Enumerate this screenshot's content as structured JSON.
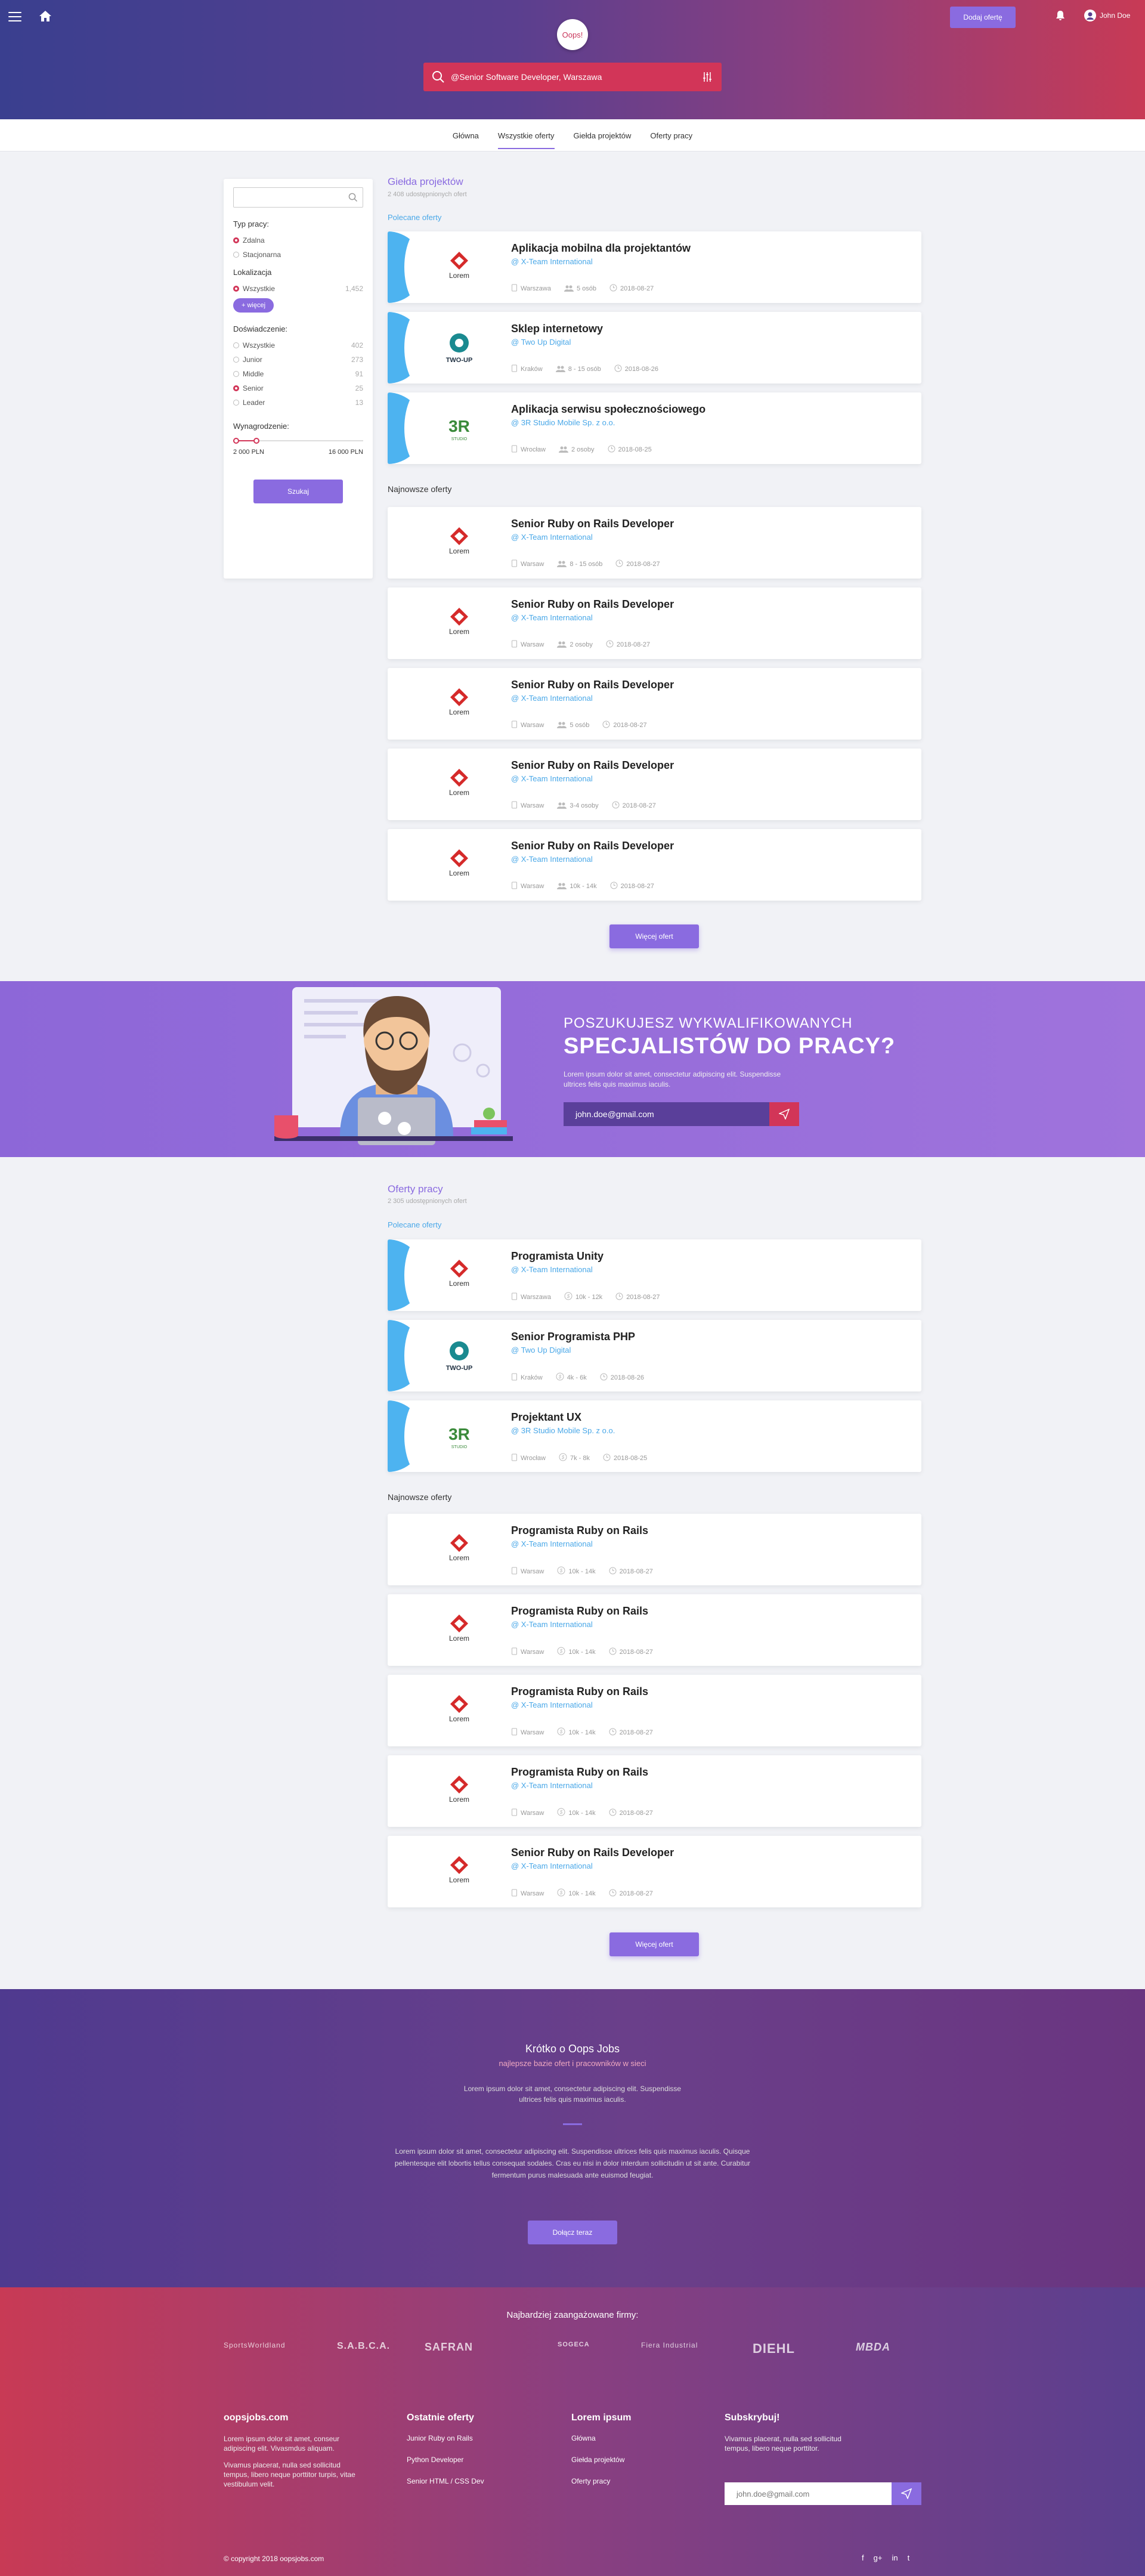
{
  "header": {
    "logo": "Oops!",
    "add_offer": "Dodaj ofertę",
    "user": "John Doe",
    "search": "@Senior Software Developer, Warszawa"
  },
  "tabs": [
    "Główna",
    "Wszystkie oferty",
    "Giełda projektów",
    "Oferty pracy"
  ],
  "sidebar": {
    "work_type_title": "Typ pracy:",
    "work_types": [
      "Zdalna",
      "Stacjonarna"
    ],
    "location_title": "Lokalizacja",
    "location": {
      "label": "Wszystkie",
      "count": "1,452"
    },
    "more": "+ więcej",
    "exp_title": "Doświadczenie:",
    "exp": [
      {
        "label": "Wszystkie",
        "count": "402"
      },
      {
        "label": "Junior",
        "count": "273"
      },
      {
        "label": "Middle",
        "count": "91"
      },
      {
        "label": "Senior",
        "count": "25"
      },
      {
        "label": "Leader",
        "count": "13"
      }
    ],
    "salary_title": "Wynagrodzenie:",
    "salary_min": "2 000 PLN",
    "salary_max": "16 000 PLN",
    "salary_fraction": 0.18,
    "search_btn": "Szukaj"
  },
  "projects": {
    "title": "Giełda projektów",
    "subtitle": "2 408 udostępnionych ofert",
    "featured_label": "Polecane oferty",
    "newest_label": "Najnowsze oferty",
    "more_btn": "Więcej ofert",
    "featured": [
      {
        "title": "Aplikacja mobilna dla projektantów",
        "company": "@ X-Team International",
        "city": "Warszawa",
        "people": "5 osób",
        "date": "2018-08-27",
        "logo": "Lorem"
      },
      {
        "title": "Sklep internetowy",
        "company": "@ Two Up Digital",
        "city": "Kraków",
        "people": "8 - 15 osób",
        "date": "2018-08-26",
        "logo": "TWO-UP"
      },
      {
        "title": "Aplikacja serwisu społecznościowego",
        "company": "@ 3R Studio Mobile Sp. z o.o.",
        "city": "Wrocław",
        "people": "2 osoby",
        "date": "2018-08-25",
        "logo": "3R"
      }
    ],
    "newest": [
      {
        "title": "Senior Ruby on Rails Developer",
        "company": "@ X-Team International",
        "city": "Warsaw",
        "people": "8 - 15 osób",
        "date": "2018-08-27",
        "logo": "Lorem"
      },
      {
        "title": "Senior Ruby on Rails Developer",
        "company": "@ X-Team International",
        "city": "Warsaw",
        "people": "2 osoby",
        "date": "2018-08-27",
        "logo": "Lorem"
      },
      {
        "title": "Senior Ruby on Rails Developer",
        "company": "@ X-Team International",
        "city": "Warsaw",
        "people": "5 osób",
        "date": "2018-08-27",
        "logo": "Lorem"
      },
      {
        "title": "Senior Ruby on Rails Developer",
        "company": "@ X-Team International",
        "city": "Warsaw",
        "people": "3-4 osoby",
        "date": "2018-08-27",
        "logo": "Lorem"
      },
      {
        "title": "Senior Ruby on Rails Developer",
        "company": "@ X-Team International",
        "city": "Warsaw",
        "people": "10k - 14k",
        "date": "2018-08-27",
        "logo": "Lorem"
      }
    ]
  },
  "banner": {
    "line1": "POSZUKUJESZ WYKWALIFIKOWANYCH",
    "line2": "SPECJALISTÓW DO PRACY?",
    "text": "Lorem ipsum dolor sit amet, consectetur adipiscing elit. Suspendisse ultrices felis quis maximus iaculis.",
    "email": "john.doe@gmail.com"
  },
  "jobs": {
    "title": "Oferty pracy",
    "subtitle": "2 305 udostępnionych ofert",
    "featured_label": "Polecane oferty",
    "newest_label": "Najnowsze oferty",
    "more_btn": "Więcej ofert",
    "featured": [
      {
        "title": "Programista Unity",
        "company": "@ X-Team International",
        "city": "Warszawa",
        "salary": "10k - 12k",
        "date": "2018-08-27",
        "logo": "Lorem"
      },
      {
        "title": "Senior Programista PHP",
        "company": "@ Two Up Digital",
        "city": "Kraków",
        "salary": "4k - 6k",
        "date": "2018-08-26",
        "logo": "TWO-UP"
      },
      {
        "title": "Projektant UX",
        "company": "@ 3R Studio Mobile Sp. z o.o.",
        "city": "Wrocław",
        "salary": "7k - 8k",
        "date": "2018-08-25",
        "logo": "3R"
      }
    ],
    "newest": [
      {
        "title": "Programista Ruby on Rails",
        "company": "@ X-Team International",
        "city": "Warsaw",
        "salary": "10k - 14k",
        "date": "2018-08-27",
        "logo": "Lorem"
      },
      {
        "title": "Programista Ruby on Rails",
        "company": "@ X-Team International",
        "city": "Warsaw",
        "salary": "10k - 14k",
        "date": "2018-08-27",
        "logo": "Lorem"
      },
      {
        "title": "Programista Ruby on Rails",
        "company": "@ X-Team International",
        "city": "Warsaw",
        "salary": "10k - 14k",
        "date": "2018-08-27",
        "logo": "Lorem"
      },
      {
        "title": "Programista Ruby on Rails",
        "company": "@ X-Team International",
        "city": "Warsaw",
        "salary": "10k - 14k",
        "date": "2018-08-27",
        "logo": "Lorem"
      },
      {
        "title": "Senior Ruby on Rails Developer",
        "company": "@ X-Team International",
        "city": "Warsaw",
        "salary": "10k - 14k",
        "date": "2018-08-27",
        "logo": "Lorem"
      }
    ]
  },
  "about": {
    "title": "Krótko o Oops Jobs",
    "tagline": "najlepsze bazie ofert i pracowników w sieci",
    "short": "Lorem ipsum dolor sit amet, consectetur adipiscing elit. Suspendisse ultrices felis quis maximus iaculis.",
    "long": "Lorem ipsum dolor sit amet, consectetur adipiscing elit. Suspendisse ultrices felis quis maximus iaculis. Quisque pellentesque elit lobortis tellus consequat sodales. Cras eu nisi in dolor interdum sollicitudin ut sit ante. Curabitur fermentum purus malesuada ante euismod feugiat.",
    "join": "Dołącz teraz"
  },
  "footer": {
    "brands_title": "Najbardziej zaangażowane firmy:",
    "brands": [
      "SportsWorldland",
      "S.A.B.C.A.",
      "SAFRAN",
      "SOGECA",
      "Fiera Industrial",
      "DIEHL",
      "MBDA"
    ],
    "about_title": "oopsjobs.com",
    "about_p1": "Lorem ipsum dolor sit amet, conseur adipiscing elit. Vivasmdus aliquam.",
    "about_p2": "Vivamus placerat, nulla sed sollicitud tempus, libero neque porttitor turpis, vitae vestibulum velit.",
    "recent_title": "Ostatnie oferty",
    "recent": [
      "Junior Ruby on Rails",
      "Python Developer",
      "Senior HTML / CSS Dev"
    ],
    "lorem_title": "Lorem ipsum",
    "lorem_links": [
      "Główna",
      "Giełda projektów",
      "Oferty pracy"
    ],
    "sub_title": "Subskrybuj!",
    "sub_text": "Vivamus placerat, nulla sed sollicitud tempus, libero neque porttitor.",
    "sub_email": "john.doe@gmail.com",
    "copyright": "© copyright 2018 oopsjobs.com",
    "social": [
      "f",
      "g+",
      "in",
      "t"
    ]
  },
  "colors": {
    "primary": "#8a6be0",
    "accent": "#d23558",
    "link": "#4aa8e8"
  }
}
